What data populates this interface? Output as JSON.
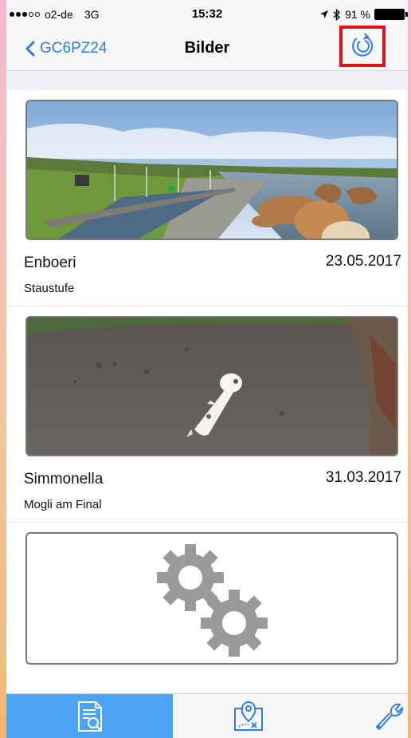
{
  "status_bar": {
    "carrier": "o2-de",
    "network": "3G",
    "time": "15:32",
    "battery": "91 %"
  },
  "nav": {
    "back_label": "GC6PZ24",
    "title": "Bilder"
  },
  "images": [
    {
      "name": "Enboeri",
      "date": "23.05.2017",
      "description": "Staustufe",
      "kind": "photo-river"
    },
    {
      "name": "Simmonella",
      "date": "31.03.2017",
      "description": "Mogli am Final",
      "kind": "photo-ground"
    },
    {
      "name": "",
      "date": "",
      "description": "",
      "kind": "loading-placeholder"
    }
  ],
  "tabs": [
    {
      "icon": "document-search-icon",
      "active": true
    },
    {
      "icon": "map-pin-icon",
      "active": false
    },
    {
      "icon": "wrench-icon",
      "active": false
    }
  ],
  "colors": {
    "accent": "#2f7de1",
    "tab_active": "#4da3f2",
    "highlight_box": "#e3111b"
  }
}
